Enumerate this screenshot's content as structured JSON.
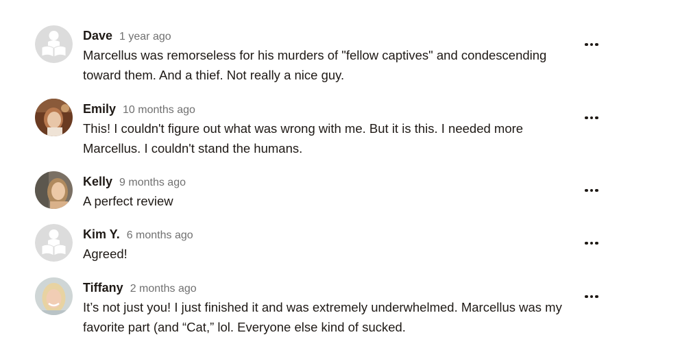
{
  "comments": [
    {
      "username": "Dave",
      "timestamp": "1 year ago",
      "body": "Marcellus was remorseless for his murders of \"fellow captives\" and condescending toward them. And a thief. Not really a nice guy.",
      "avatar": "default-reader-avatar"
    },
    {
      "username": "Emily",
      "timestamp": "10 months ago",
      "body": "This! I couldn't figure out what was wrong with me. But it is this. I needed more Marcellus. I couldn't stand the humans.",
      "avatar": "user-photo-avatar"
    },
    {
      "username": "Kelly",
      "timestamp": "9 months ago",
      "body": "A perfect review",
      "avatar": "user-photo-avatar"
    },
    {
      "username": "Kim Y.",
      "timestamp": "6 months ago",
      "body": "Agreed!",
      "avatar": "default-reader-avatar"
    },
    {
      "username": "Tiffany",
      "timestamp": "2 months ago",
      "body": "It’s not just you! I just finished it and was extremely underwhelmed. Marcellus was my favorite part (and “Cat,” lol. Everyone else kind of sucked.",
      "avatar": "user-photo-avatar"
    }
  ],
  "icons": {
    "more": "more-options-icon"
  }
}
